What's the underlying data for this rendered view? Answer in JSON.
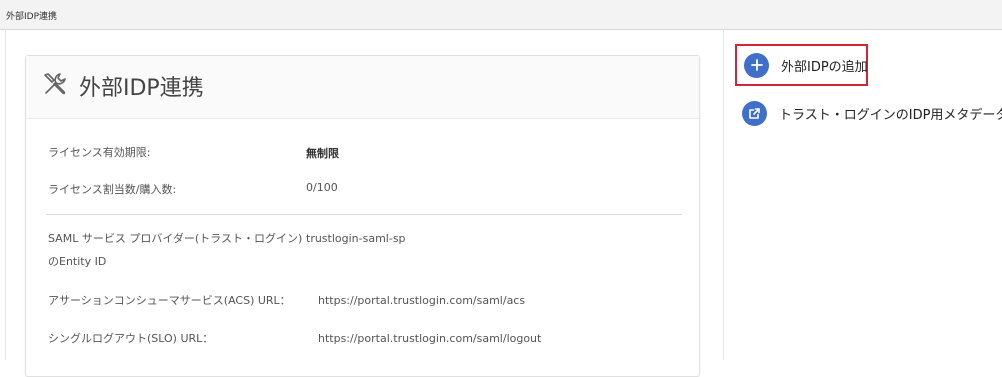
{
  "topbar": {
    "breadcrumb": "外部IDP連携"
  },
  "card": {
    "title": "外部IDP連携",
    "rows": [
      {
        "label": "ライセンス有効期限:",
        "value": "無制限"
      },
      {
        "label": "ライセンス割当数/購入数:",
        "value": "0/100"
      },
      {
        "label_line1": "SAML サービス プロバイダー(トラスト・ログイン)",
        "label_line2": "のEntity ID",
        "value": "trustlogin-saml-sp"
      },
      {
        "label": "アサーションコンシューマサービス(ACS) URL：",
        "value": "https://portal.trustlogin.com/saml/acs"
      },
      {
        "label": "シングルログアウト(SLO) URL：",
        "value": "https://portal.trustlogin.com/saml/logout"
      }
    ]
  },
  "actions": {
    "add_label": "外部IDPの追加",
    "metadata_label": "トラスト・ログインのIDP用メタデータ"
  },
  "colors": {
    "accent": "#3f6fc8",
    "highlight": "#d0253a"
  },
  "icons": {
    "card": "tools-icon",
    "add": "plus-icon",
    "metadata": "external-link-icon"
  }
}
